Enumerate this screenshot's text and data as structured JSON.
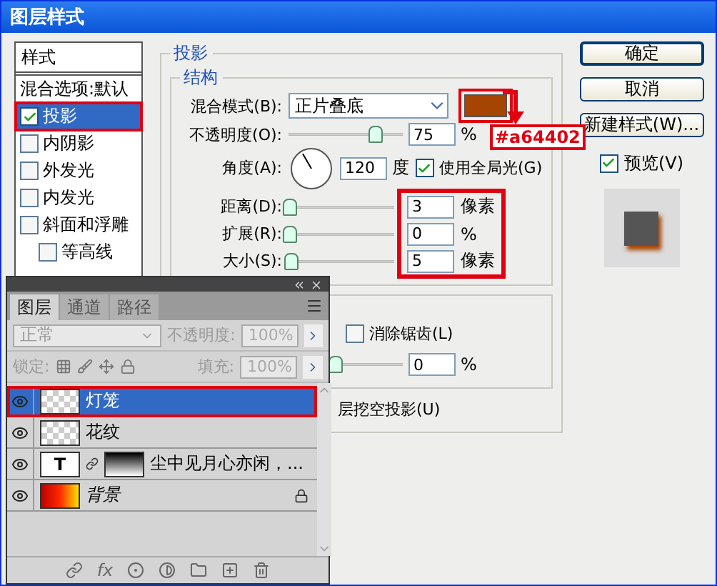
{
  "window": {
    "title": "图层样式"
  },
  "styles_list": {
    "header": "样式",
    "items": [
      {
        "label": "混合选项:默认",
        "kind": "plain",
        "selected": false,
        "highlighted": false
      },
      {
        "label": "投影",
        "kind": "check",
        "checked": true,
        "selected": true,
        "highlighted": true
      },
      {
        "label": "内阴影",
        "kind": "check",
        "checked": false,
        "selected": false,
        "highlighted": false
      },
      {
        "label": "外发光",
        "kind": "check",
        "checked": false,
        "selected": false,
        "highlighted": false
      },
      {
        "label": "内发光",
        "kind": "check",
        "checked": false,
        "selected": false,
        "highlighted": false
      },
      {
        "label": "斜面和浮雕",
        "kind": "check",
        "checked": false,
        "selected": false,
        "highlighted": false
      },
      {
        "label": "等高线",
        "kind": "subcheck",
        "checked": false,
        "selected": false,
        "highlighted": false
      }
    ]
  },
  "drop_shadow": {
    "title": "投影",
    "structure": {
      "title": "结构",
      "blend_mode": {
        "label": "混合模式(B):",
        "value": "正片叠底",
        "color": "#a64402",
        "highlighted": true
      },
      "opacity": {
        "label": "不透明度(O):",
        "level": 0.75,
        "value": "75",
        "unit": "%"
      },
      "angle": {
        "label": "角度(A):",
        "value": "120",
        "unit": "度",
        "global_light": {
          "label": "使用全局光(G)",
          "checked": true
        }
      },
      "params_highlighted": true,
      "params": [
        {
          "label": "距离(D):",
          "level": 0.01,
          "value": "3",
          "unit": "像素"
        },
        {
          "label": "扩展(R):",
          "level": 0,
          "value": "0",
          "unit": "%"
        },
        {
          "label": "大小(S):",
          "level": 0.02,
          "value": "5",
          "unit": "像素"
        }
      ]
    },
    "quality": {
      "anti_alias": {
        "label": "消除锯齿(L)",
        "checked": false
      },
      "noise": {
        "level": 0,
        "value": "0",
        "unit": "%"
      }
    },
    "knockout": {
      "label": "层挖空投影(U)"
    }
  },
  "annotation": {
    "text": "#a64402"
  },
  "buttons": [
    {
      "label": "确定",
      "default": true
    },
    {
      "label": "取消",
      "default": false
    },
    {
      "label": "新建样式(W)...",
      "default": false
    }
  ],
  "preview": {
    "label": "预览(V)",
    "checked": true
  },
  "layers_panel": {
    "tabs": [
      {
        "label": "图层",
        "selected": true
      },
      {
        "label": "通道",
        "selected": false
      },
      {
        "label": "路径",
        "selected": false
      }
    ],
    "blend_mode": {
      "value": "正常",
      "disabled": true
    },
    "opacity": {
      "label": "不透明度:",
      "value": "100%",
      "disabled": true
    },
    "lock_label": "锁定:",
    "fill": {
      "label": "填充:",
      "value": "100%",
      "disabled": true
    },
    "layers": [
      {
        "name": "灯笼",
        "kind": "pixel",
        "selected": true,
        "highlighted": true,
        "visible": true,
        "locked": false
      },
      {
        "name": "花纹",
        "kind": "pixel",
        "selected": false,
        "highlighted": false,
        "visible": true,
        "locked": false
      },
      {
        "name": "尘中见月心亦闲，...",
        "kind": "text",
        "glyph": "T",
        "selected": false,
        "highlighted": false,
        "visible": true,
        "locked": false
      },
      {
        "name": "背景",
        "kind": "background",
        "selected": false,
        "highlighted": false,
        "visible": true,
        "locked": true
      }
    ],
    "effects_label": "fx"
  }
}
